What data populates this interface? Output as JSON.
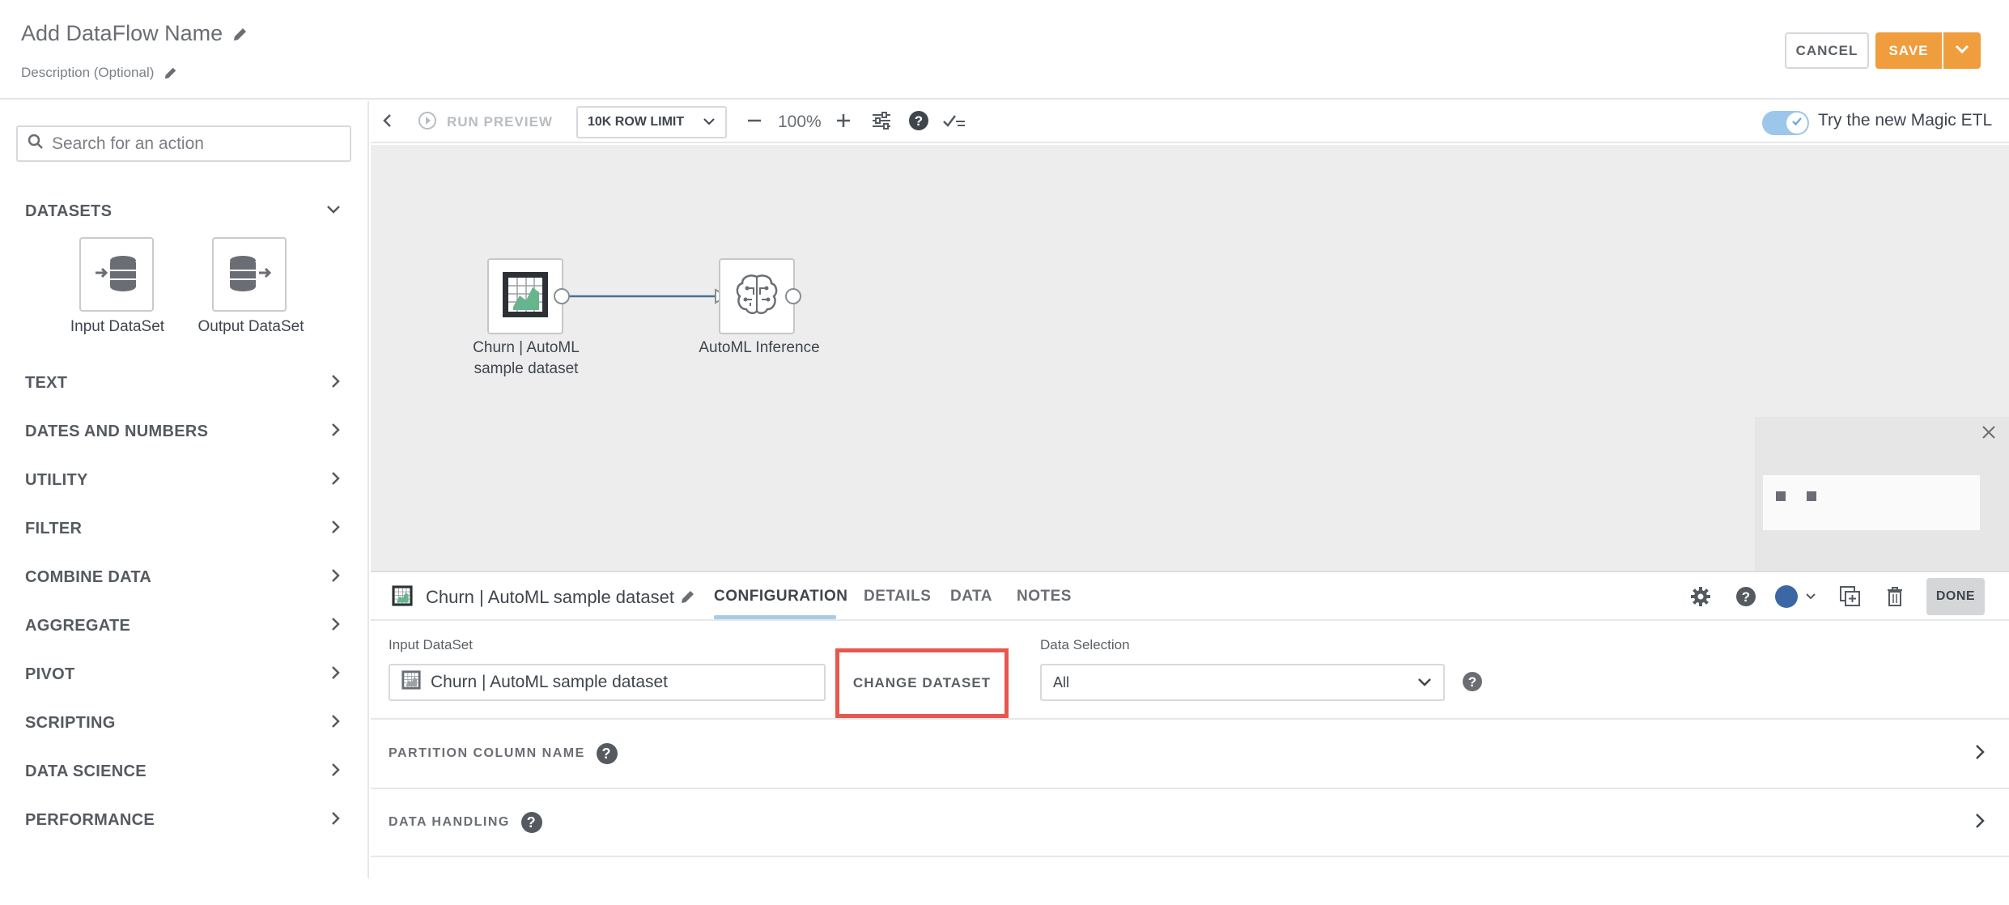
{
  "header": {
    "title": "Add DataFlow Name",
    "description": "Description (Optional)",
    "cancel_label": "CANCEL",
    "save_label": "SAVE"
  },
  "sidebar": {
    "search_placeholder": "Search for an action",
    "datasets_label": "DATASETS",
    "input_dataset_label": "Input DataSet",
    "output_dataset_label": "Output DataSet",
    "categories": [
      {
        "label": "TEXT"
      },
      {
        "label": "DATES AND NUMBERS"
      },
      {
        "label": "UTILITY"
      },
      {
        "label": "FILTER"
      },
      {
        "label": "COMBINE DATA"
      },
      {
        "label": "AGGREGATE"
      },
      {
        "label": "PIVOT"
      },
      {
        "label": "SCRIPTING"
      },
      {
        "label": "DATA SCIENCE"
      },
      {
        "label": "PERFORMANCE"
      }
    ]
  },
  "toolbar": {
    "run_preview_label": "RUN PREVIEW",
    "row_limit": "10K ROW LIMIT",
    "zoom": "100%",
    "magic_etl_label": "Try the new Magic ETL",
    "magic_etl_enabled": true
  },
  "canvas": {
    "nodes": [
      {
        "label_line1": "Churn | AutoML",
        "label_line2": "sample dataset"
      },
      {
        "label_line1": "AutoML Inference"
      }
    ]
  },
  "panel": {
    "title": "Churn | AutoML sample dataset",
    "tabs": [
      {
        "label": "CONFIGURATION",
        "active": true
      },
      {
        "label": "DETAILS",
        "active": false
      },
      {
        "label": "DATA",
        "active": false
      },
      {
        "label": "NOTES",
        "active": false
      }
    ],
    "done_label": "DONE",
    "node_color": "#3c67a5",
    "input_dataset_label": "Input DataSet",
    "input_dataset_value": "Churn | AutoML sample dataset",
    "change_dataset_label": "CHANGE DATASET",
    "data_selection_label": "Data Selection",
    "data_selection_value": "All",
    "partition_label": "PARTITION COLUMN NAME",
    "data_handling_label": "DATA HANDLING"
  },
  "colors": {
    "accent_orange": "#f09d3d",
    "highlight_red": "#e8574f",
    "toggle_blue": "#9cc6ea",
    "connector_blue": "#4a6e9a"
  }
}
